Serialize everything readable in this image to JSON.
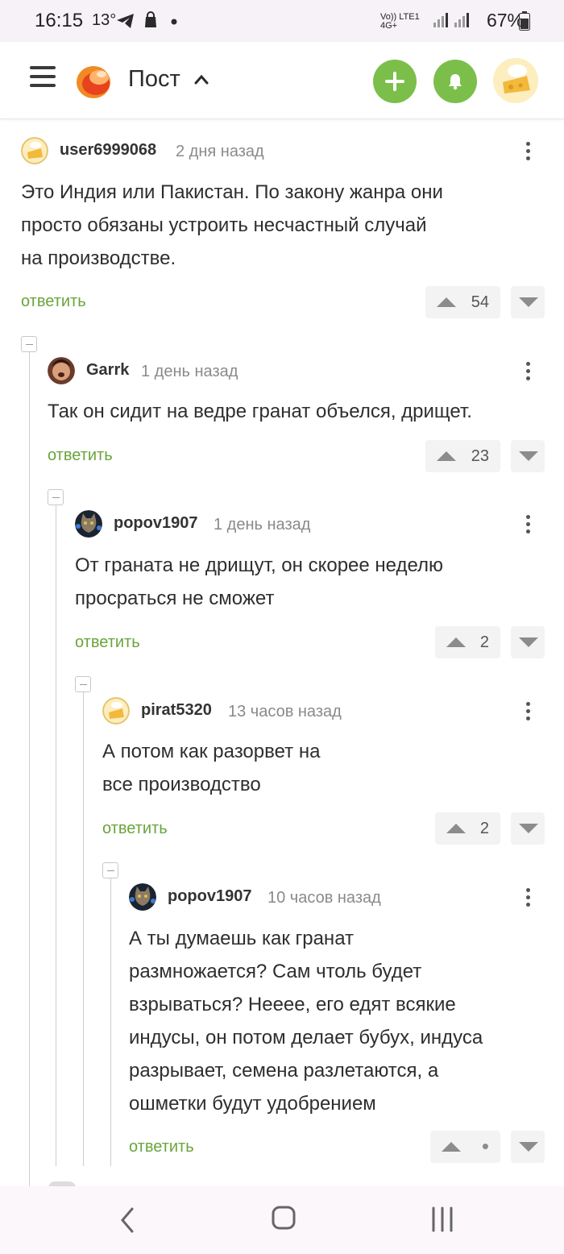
{
  "status_bar": {
    "time": "16:15",
    "temperature": "13°",
    "network": "Vo)) LTE1 4G+",
    "battery": "67%"
  },
  "header": {
    "title": "Пост",
    "colors": {
      "accent": "#7bbf4a",
      "reply_link": "#6aa43b"
    }
  },
  "comments": [
    {
      "author": "user6999068",
      "time": "2 дня назад",
      "lines": [
        "Это Индия или Пакистан. По закону жанра они",
        "просто обязаны устроить несчастный случай",
        "на производстве."
      ],
      "reply": "ответить",
      "votes": "54"
    },
    {
      "author": "Garrk",
      "time": "1 день назад",
      "lines": [
        "Так он сидит на ведре гранат объелся, дрищет."
      ],
      "reply": "ответить",
      "votes": "23"
    },
    {
      "author": "popov1907",
      "time": "1 день назад",
      "lines": [
        "От граната не дрищут, он скорее неделю",
        "просраться не сможет"
      ],
      "reply": "ответить",
      "votes": "2"
    },
    {
      "author": "pirat5320",
      "time": "13 часов назад",
      "lines": [
        "А потом как разорвет на",
        "все производство"
      ],
      "reply": "ответить",
      "votes": "2"
    },
    {
      "author": "popov1907",
      "time": "10 часов назад",
      "lines": [
        "А ты думаешь как гранат",
        "размножается? Сам чтоль будет",
        "взрываться? Нееее, его едят всякие",
        "индусы, он потом делает бубух, индуса",
        "разрывает, семена разлетаются, а",
        "ошметки будут удобрением"
      ],
      "reply": "ответить",
      "votes": "•"
    }
  ]
}
